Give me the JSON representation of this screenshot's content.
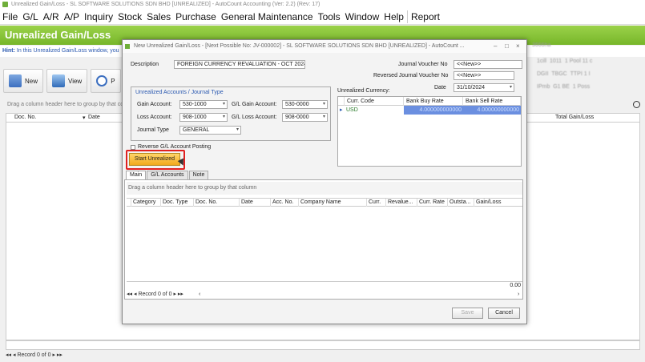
{
  "window_title": "Unrealized Gain/Loss - SL SOFTWARE SOLUTIONS SDN BHD [UNREALIZED] - AutoCount Accounting (Ver: 2.2) (Rev: 17)",
  "menu": [
    "File",
    "G/L",
    "A/R",
    "A/P",
    "Inquiry",
    "Stock",
    "Sales",
    "Purchase",
    "General Maintenance",
    "Tools",
    "Window",
    "Help",
    "Report"
  ],
  "page_title": "Unrealized Gain/Loss",
  "hint": {
    "label": "Hint:",
    "text": "In this Unrealized Gain/Loss window, you"
  },
  "toolbar": {
    "new": "New",
    "view": "View",
    "preview": "P"
  },
  "main_grid": {
    "group_hint": "Drag a column header here to group by that col",
    "columns": [
      "Doc. No.",
      "Date",
      "Total Gain/Loss"
    ],
    "record_text": "Record 0 of 0"
  },
  "background_right": {
    "header": "3666ha",
    "rows": [
      [
        "1cill",
        "1011",
        "1 Pool 11 c"
      ],
      [
        "DGII",
        "TBGC",
        "TTPI 1 I"
      ],
      [
        "IPmb",
        "G1 BE",
        "1 Poss"
      ]
    ]
  },
  "dialog": {
    "title": "New Unrealized Gain/Loss - [Next Possible No: JV-000002] - SL SOFTWARE SOLUTIONS SDN BHD [UNREALIZED] - AutoCount ...",
    "controls": [
      "–",
      "□",
      "×"
    ],
    "description_label": "Description",
    "description_value": "FOREIGN CURRENCY REVALUATION - OCT 2024",
    "jv_label": "Journal Voucher No",
    "jv_value": "<<New>>",
    "rev_jv_label": "Reversed Journal Voucher No",
    "rev_jv_value": "<<New>>",
    "date_label": "Date",
    "date_value": "31/10/2024",
    "accounts_group_title": "Unrealized Accounts / Journal Type",
    "gain_account_label": "Gain Account:",
    "gain_account_value": "530-1000",
    "gl_gain_account_label": "G/L Gain Account:",
    "gl_gain_account_value": "530-0000",
    "loss_account_label": "Loss Account:",
    "loss_account_value": "908-1000",
    "gl_loss_account_label": "G/L Loss Account:",
    "gl_loss_account_value": "908-0000",
    "journal_type_label": "Journal Type",
    "journal_type_value": "GENERAL",
    "reverse_posting_label": "Reverse G/L Account Posting",
    "start_button": "Start Unrealized",
    "unrealized_currency_label": "Unrealized Currency:",
    "currency_columns": [
      "Curr. Code",
      "Bank Buy Rate",
      "Bank Sell Rate"
    ],
    "currency_rows": [
      {
        "code": "USD",
        "buy": "4.000000000000",
        "sell": "4.000000000000"
      }
    ],
    "tabs": [
      "Main",
      "G/L Accounts",
      "Note"
    ],
    "detail_group_hint": "Drag a column header here to group by that column",
    "detail_columns": [
      "Category",
      "Doc. Type",
      "Doc. No.",
      "Date",
      "Acc. No.",
      "Company Name",
      "Curr.",
      "Revalue...",
      "Curr. Rate",
      "Outsta...",
      "Gain/Loss"
    ],
    "total_value": "0.00",
    "record_text": "Record 0 of 0",
    "save_button": "Save",
    "cancel_button": "Cancel"
  }
}
